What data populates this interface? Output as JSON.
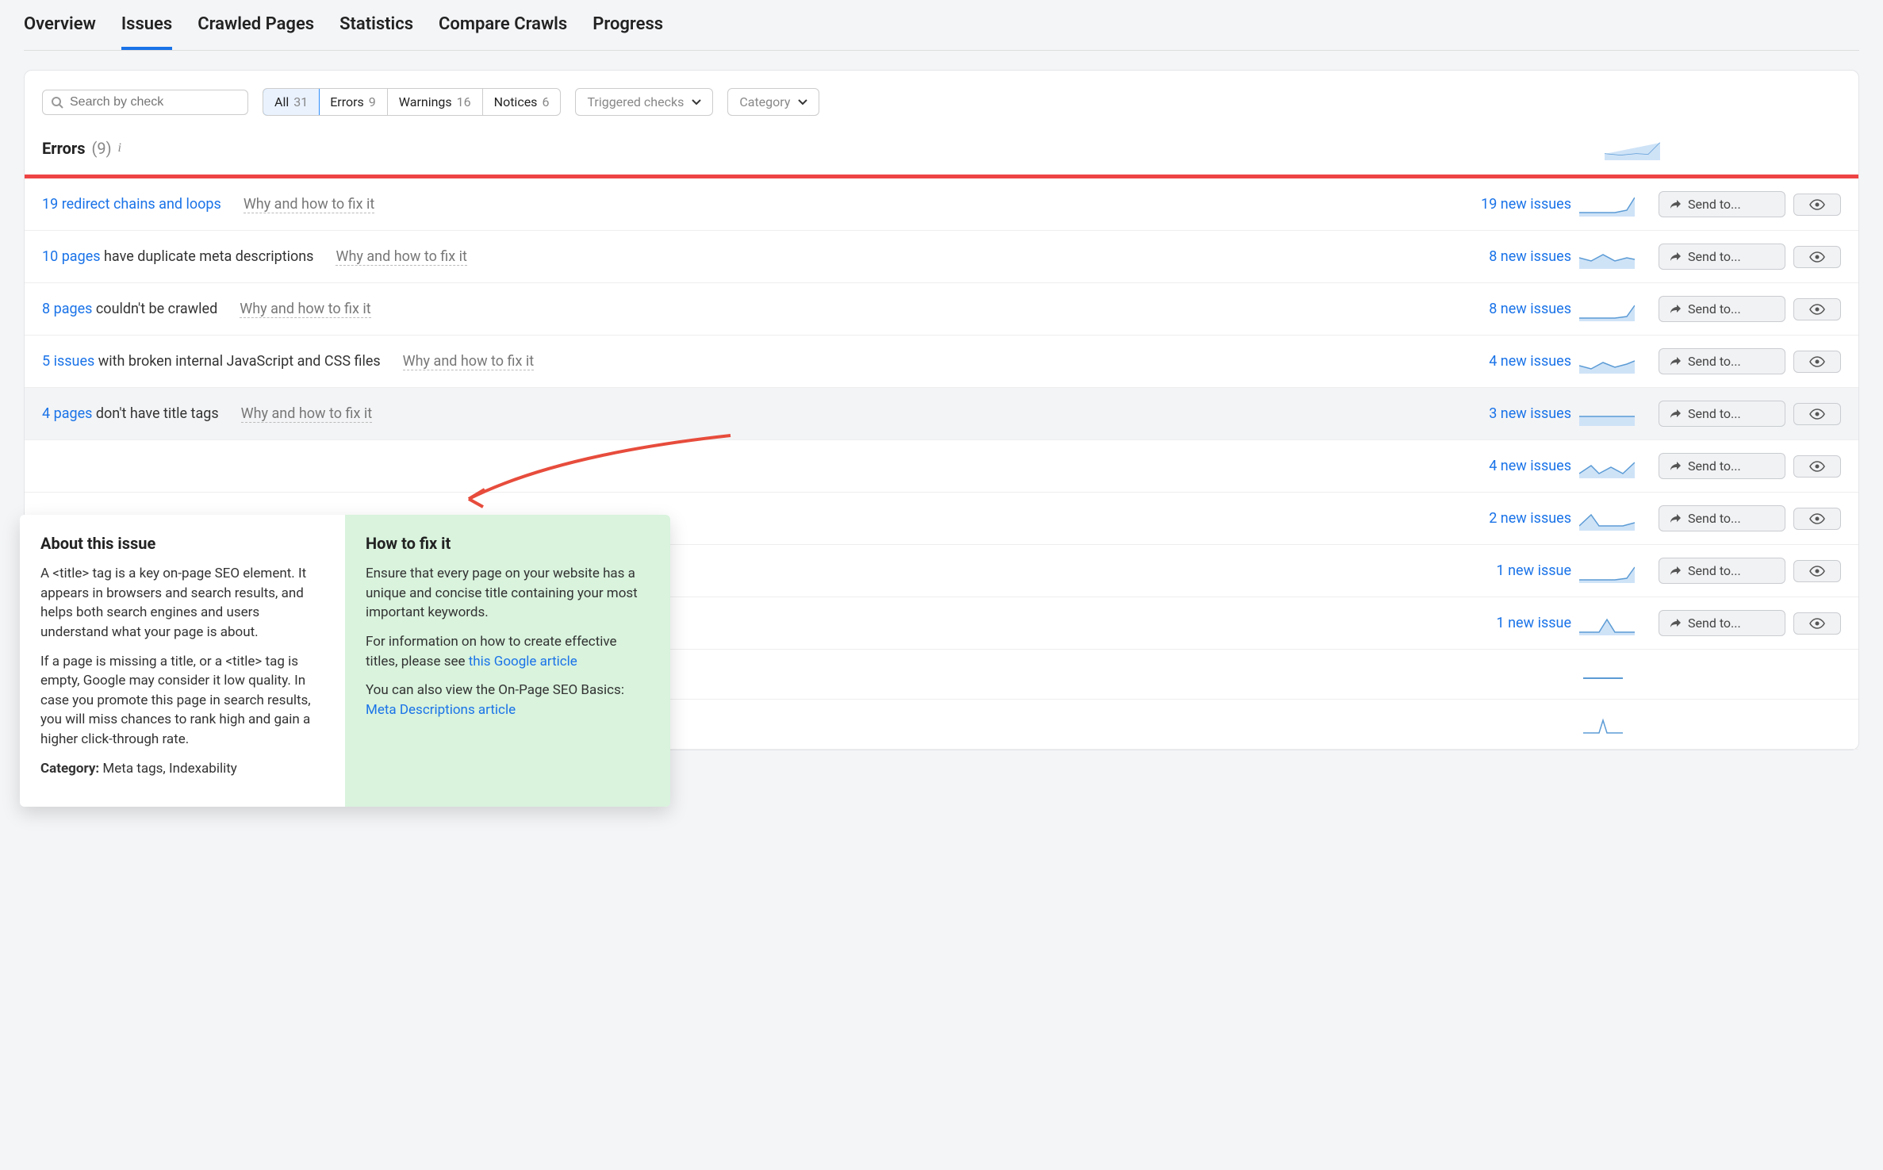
{
  "tabs": [
    "Overview",
    "Issues",
    "Crawled Pages",
    "Statistics",
    "Compare Crawls",
    "Progress"
  ],
  "active_tab": 1,
  "search": {
    "placeholder": "Search by check"
  },
  "filters": {
    "seg": [
      {
        "label": "All",
        "count": "31"
      },
      {
        "label": "Errors",
        "count": "9"
      },
      {
        "label": "Warnings",
        "count": "16"
      },
      {
        "label": "Notices",
        "count": "6"
      }
    ],
    "seg_active": 0,
    "dd1": "Triggered checks",
    "dd2": "Category"
  },
  "section": {
    "title": "Errors",
    "count": "(9)"
  },
  "fix_label": "Why and how to fix it",
  "sendto_label": "Send to...",
  "rows": [
    {
      "link": "19 redirect chains and loops",
      "rest": "",
      "new": "19 new issues"
    },
    {
      "link": "10 pages",
      "rest": " have duplicate meta descriptions",
      "new": "8 new issues"
    },
    {
      "link": "8 pages",
      "rest": " couldn't be crawled",
      "new": "8 new issues"
    },
    {
      "link": "5 issues",
      "rest": " with broken internal JavaScript and CSS files",
      "new": "4 new issues"
    },
    {
      "link": "4 pages",
      "rest": " don't have title tags",
      "new": "3 new issues",
      "hover": true
    },
    {
      "link": "",
      "rest": "",
      "new": "4 new issues"
    },
    {
      "link": "",
      "rest": "",
      "new": "2 new issues"
    },
    {
      "link": "",
      "rest": "",
      "new": "1 new issue"
    },
    {
      "link": "",
      "rest": "",
      "new": "1 new issue"
    }
  ],
  "popup": {
    "about_title": "About this issue",
    "about_p1": "A <title> tag is a key on-page SEO element. It appears in browsers and search results, and helps both search engines and users understand what your page is about.",
    "about_p2": "If a page is missing a title, or a <title> tag is empty, Google may consider it low quality. In case you promote this page in search results, you will miss chances to rank high and gain a higher click-through rate.",
    "cat_label": "Category:",
    "cat_value": " Meta tags, Indexability",
    "fix_title": "How to fix it",
    "fix_p1": "Ensure that every page on your website has a unique and concise title containing your most important keywords.",
    "fix_p2a": "For information on how to create effective titles, please see ",
    "fix_link1": "this Google article",
    "fix_p3a": "You can also view the On-Page SEO Basics: ",
    "fix_link2": "Meta Descriptions article"
  }
}
